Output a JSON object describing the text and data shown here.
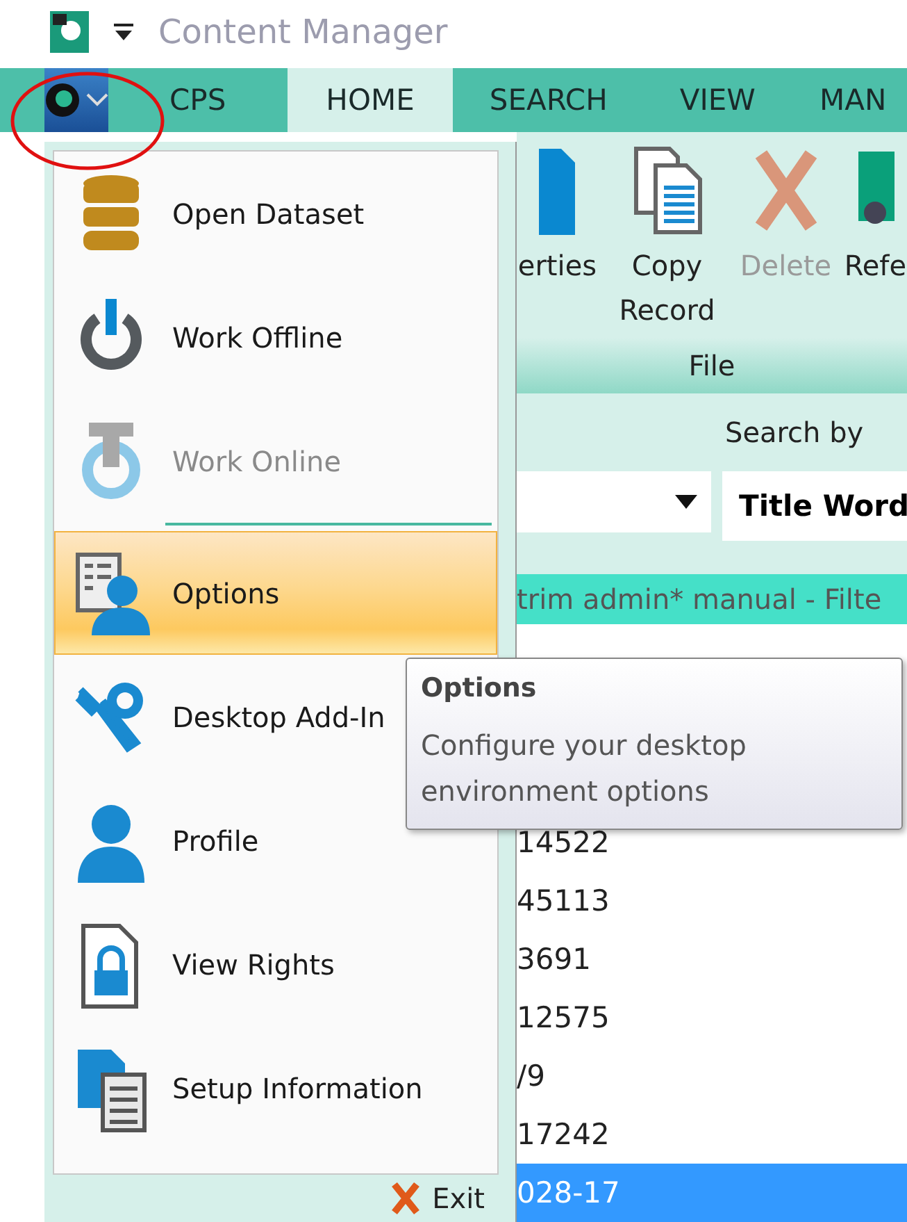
{
  "window": {
    "title": "Content Manager"
  },
  "app_button": {
    "expanded": true
  },
  "tabs": [
    {
      "label": "CPS",
      "selected": false
    },
    {
      "label": "HOME",
      "selected": true
    },
    {
      "label": "SEARCH",
      "selected": false
    },
    {
      "label": "VIEW",
      "selected": false
    },
    {
      "label": "MAN",
      "selected": false
    }
  ],
  "ribbon": {
    "buttons": [
      {
        "label": "erties",
        "kind": "properties",
        "disabled": false
      },
      {
        "label": "Copy Record",
        "kind": "copy",
        "disabled": false
      },
      {
        "label": "Delete",
        "kind": "delete",
        "disabled": true
      },
      {
        "label": "Refe",
        "kind": "reference",
        "disabled": false
      }
    ],
    "group_label": "File"
  },
  "search": {
    "label": "Search by",
    "field_value": "Title Word"
  },
  "filter_bar": {
    "text": "trim admin* manual - Filte"
  },
  "rows": [
    {
      "text": "14522",
      "selected": false
    },
    {
      "text": "45113",
      "selected": false
    },
    {
      "text": "3691",
      "selected": false
    },
    {
      "text": "12575",
      "selected": false
    },
    {
      "text": "/9",
      "selected": false
    },
    {
      "text": "17242",
      "selected": false
    },
    {
      "text": "028-17",
      "selected": true
    }
  ],
  "app_menu": {
    "items": [
      {
        "label": "Open Dataset",
        "kind": "database",
        "disabled": false,
        "selected": false
      },
      {
        "label": "Work Offline",
        "kind": "power",
        "disabled": false,
        "selected": false
      },
      {
        "label": "Work Online",
        "kind": "online",
        "disabled": true,
        "selected": false
      },
      {
        "label": "Options",
        "kind": "options",
        "disabled": false,
        "selected": true
      },
      {
        "label": "Desktop Add-In",
        "kind": "addins",
        "disabled": false,
        "selected": false
      },
      {
        "label": "Profile",
        "kind": "profile",
        "disabled": false,
        "selected": false
      },
      {
        "label": "View Rights",
        "kind": "rights",
        "disabled": false,
        "selected": false
      },
      {
        "label": "Setup Information",
        "kind": "setup",
        "disabled": false,
        "selected": false
      }
    ],
    "exit_label": "Exit"
  },
  "tooltip": {
    "title": "Options",
    "text": "Configure your desktop environment options"
  }
}
